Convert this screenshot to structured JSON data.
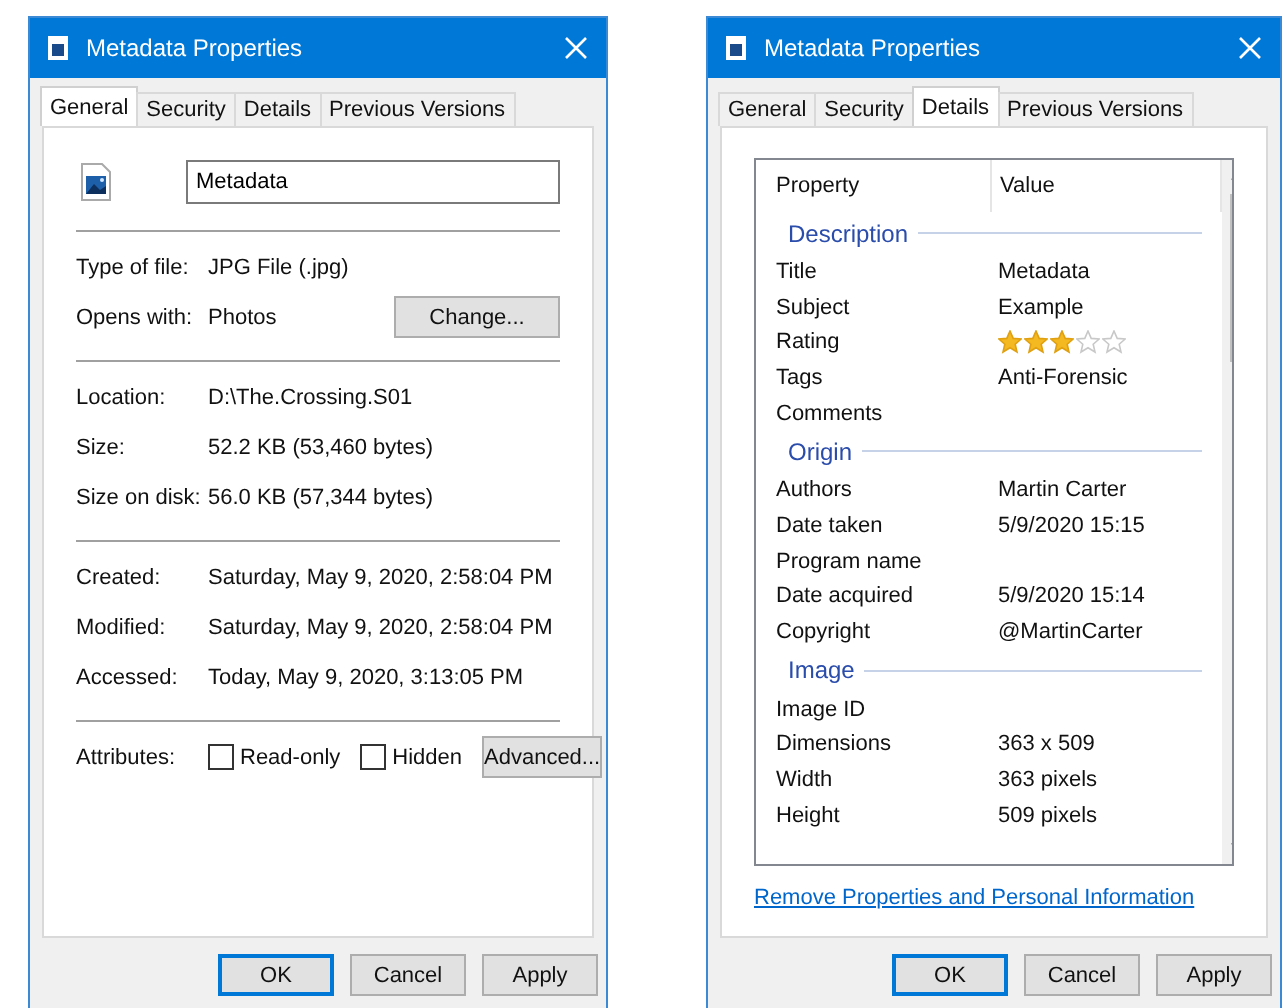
{
  "general_dialog": {
    "title": "Metadata Properties",
    "tabs": [
      {
        "label": "General",
        "selected": true
      },
      {
        "label": "Security",
        "selected": false
      },
      {
        "label": "Details",
        "selected": false
      },
      {
        "label": "Previous Versions",
        "selected": false
      }
    ],
    "name_field": {
      "value": "Metadata"
    },
    "sections": [
      [
        {
          "label": "Type of file:",
          "value": "JPG File (.jpg)"
        },
        {
          "label": "Opens with:",
          "value": "Photos",
          "button": "Change..."
        }
      ],
      [
        {
          "label": "Location:",
          "value": "D:\\The.Crossing.S01"
        },
        {
          "label": "Size:",
          "value": "52.2 KB (53,460 bytes)"
        },
        {
          "label": "Size on disk:",
          "value": "56.0 KB (57,344 bytes)"
        }
      ],
      [
        {
          "label": "Created:",
          "value": "Saturday, May 9, 2020, 2:58:04 PM"
        },
        {
          "label": "Modified:",
          "value": "Saturday, May 9, 2020, 2:58:04 PM"
        },
        {
          "label": "Accessed:",
          "value": "Today, May 9, 2020, 3:13:05 PM"
        }
      ]
    ],
    "attributes": {
      "label": "Attributes:",
      "checkboxes": [
        {
          "label": "Read-only",
          "checked": false
        },
        {
          "label": "Hidden",
          "checked": false
        }
      ],
      "button": "Advanced..."
    },
    "buttons": [
      {
        "label": "OK",
        "focused": true
      },
      {
        "label": "Cancel",
        "focused": false
      },
      {
        "label": "Apply",
        "focused": false
      }
    ]
  },
  "details_dialog": {
    "title": "Metadata Properties",
    "tabs": [
      {
        "label": "General",
        "selected": false
      },
      {
        "label": "Security",
        "selected": false
      },
      {
        "label": "Details",
        "selected": true
      },
      {
        "label": "Previous Versions",
        "selected": false
      }
    ],
    "columns": [
      "Property",
      "Value"
    ],
    "rows": [
      {
        "kind": "group",
        "label": "Description"
      },
      {
        "kind": "property",
        "property": "Title",
        "value": "Metadata"
      },
      {
        "kind": "property",
        "property": "Subject",
        "value": "Example"
      },
      {
        "kind": "rating",
        "property": "Rating",
        "stars": 3
      },
      {
        "kind": "property",
        "property": "Tags",
        "value": "Anti-Forensic"
      },
      {
        "kind": "property",
        "property": "Comments"
      },
      {
        "kind": "group",
        "label": "Origin"
      },
      {
        "kind": "property",
        "property": "Authors",
        "value": "Martin Carter"
      },
      {
        "kind": "property",
        "property": "Date taken",
        "value": "5/9/2020 15:15"
      },
      {
        "kind": "property",
        "property": "Program name"
      },
      {
        "kind": "property",
        "property": "Date acquired",
        "value": "5/9/2020 15:14"
      },
      {
        "kind": "property",
        "property": "Copyright",
        "value": "@MartinCarter"
      },
      {
        "kind": "group",
        "label": "Image"
      },
      {
        "kind": "property",
        "property": "Image ID"
      },
      {
        "kind": "property",
        "property": "Dimensions",
        "value": "363 x 509"
      },
      {
        "kind": "property",
        "property": "Width",
        "value": "363 pixels"
      },
      {
        "kind": "property",
        "property": "Height",
        "value": "509 pixels"
      }
    ],
    "link": "Remove Properties and Personal Information",
    "buttons": [
      {
        "label": "OK",
        "focused": true
      },
      {
        "label": "Cancel",
        "focused": false
      },
      {
        "label": "Apply",
        "focused": false
      }
    ]
  }
}
